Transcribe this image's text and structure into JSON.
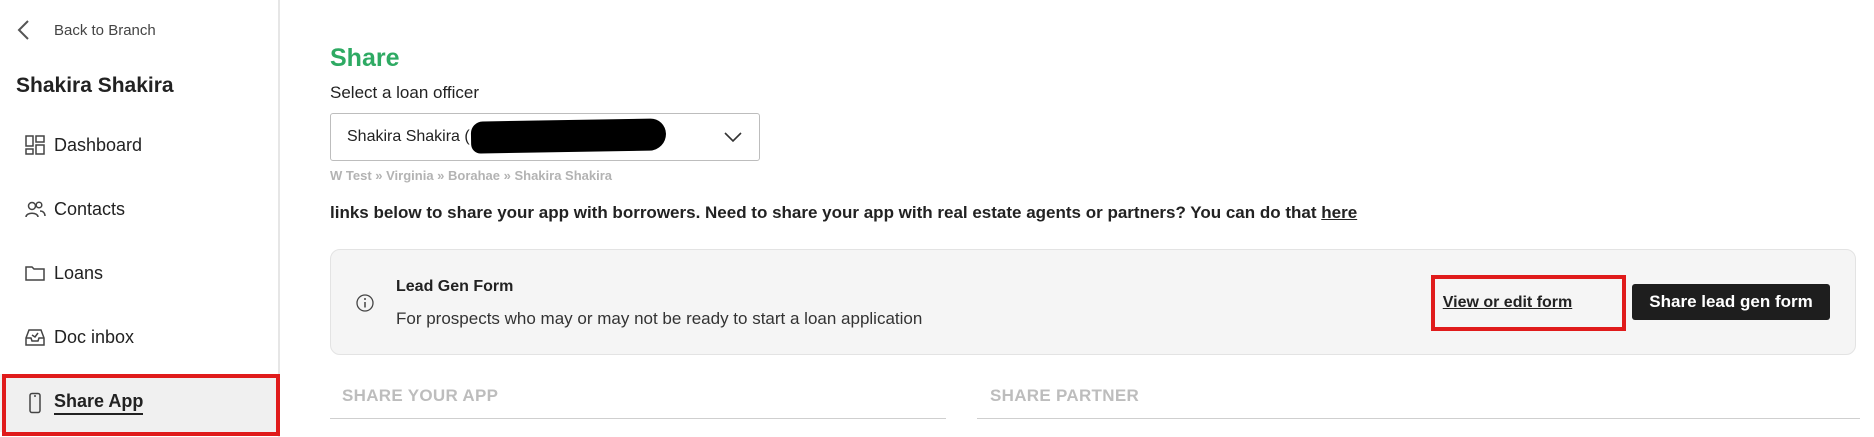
{
  "sidebar": {
    "back_label": "Back to Branch",
    "user_name": "Shakira Shakira",
    "items": [
      {
        "label": "Dashboard",
        "icon": "dashboard-icon"
      },
      {
        "label": "Contacts",
        "icon": "contacts-icon"
      },
      {
        "label": "Loans",
        "icon": "folder-icon"
      },
      {
        "label": "Doc inbox",
        "icon": "inbox-icon"
      },
      {
        "label": "Share App",
        "icon": "phone-icon",
        "active": true
      }
    ]
  },
  "main": {
    "title": "Share",
    "select_label": "Select a loan officer",
    "select_value": "Shakira Shakira (",
    "breadcrumb": "W Test » Virginia » Borahae » Shakira Shakira",
    "info_text": "links below to share your app with borrowers. Need to share your app with real estate agents or partners? You can do that ",
    "info_link": "here",
    "lead_card": {
      "title": "Lead Gen Form",
      "description": "For prospects who may or may not be ready to start a loan application",
      "edit_button": "View or edit form",
      "share_button": "Share lead gen form"
    },
    "sections": [
      "SHARE YOUR APP",
      "SHARE PARTNER"
    ]
  },
  "colors": {
    "title_green": "#2eaa63",
    "highlight_red": "#e01b1b",
    "button_dark": "#1e1e1e"
  }
}
